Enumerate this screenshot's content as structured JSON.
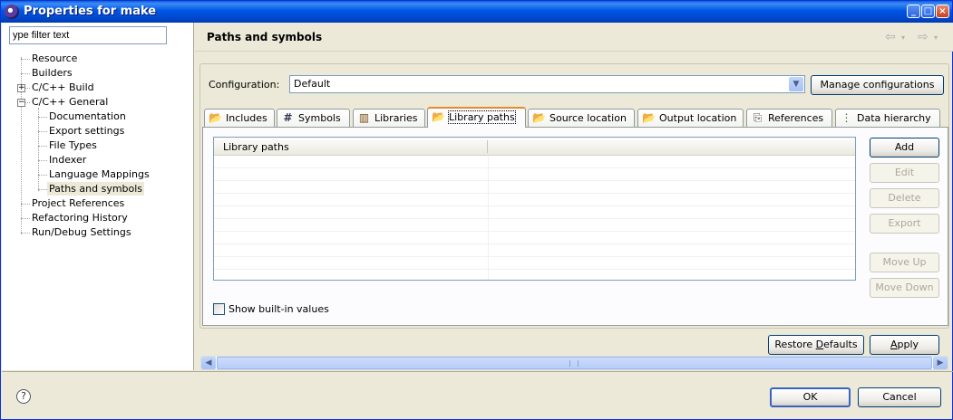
{
  "window": {
    "title": "Properties for make"
  },
  "filter": {
    "value": "ype filter text"
  },
  "tree": {
    "items": [
      {
        "label": "Resource"
      },
      {
        "label": "Builders"
      },
      {
        "label": "C/C++ Build"
      },
      {
        "label": "C/C++ General"
      },
      {
        "label": "Documentation"
      },
      {
        "label": "Export settings"
      },
      {
        "label": "File Types"
      },
      {
        "label": "Indexer"
      },
      {
        "label": "Language Mappings"
      },
      {
        "label": "Paths and symbols",
        "selected": true
      },
      {
        "label": "Project References"
      },
      {
        "label": "Refactoring History"
      },
      {
        "label": "Run/Debug Settings"
      }
    ]
  },
  "page": {
    "title": "Paths and symbols",
    "back_icon": "back-arrow-icon",
    "forward_icon": "forward-arrow-icon"
  },
  "configuration": {
    "label": "Configuration:",
    "value": "Default",
    "manage_button": "Manage configurations"
  },
  "tabs": [
    {
      "label": "Includes",
      "icon": "includes-folder-icon"
    },
    {
      "label": "Symbols",
      "icon": "hash-icon"
    },
    {
      "label": "Libraries",
      "icon": "library-books-icon"
    },
    {
      "label": "Library paths",
      "icon": "library-folder-icon",
      "active": true
    },
    {
      "label": "Source location",
      "icon": "source-folder-icon"
    },
    {
      "label": "Output location",
      "icon": "output-folder-icon"
    },
    {
      "label": "References",
      "icon": "references-icon"
    },
    {
      "label": "Data hierarchy",
      "icon": "hierarchy-icon"
    }
  ],
  "table": {
    "header": "Library paths"
  },
  "side_buttons": {
    "add": "Add",
    "edit": "Edit",
    "delete": "Delete",
    "export": "Export",
    "move_up": "Move Up",
    "move_down": "Move Down"
  },
  "show_builtin": {
    "label": "Show built-in values",
    "checked": false
  },
  "footer": {
    "restore_defaults_pre": "Restore ",
    "restore_defaults_u": "D",
    "restore_defaults_post": "efaults",
    "apply_u": "A",
    "apply_post": "pply",
    "ok": "OK",
    "cancel": "Cancel"
  },
  "colors": {
    "titlebar": "#0055e5",
    "window_bg": "#ece9d8",
    "active_tab_accent": "#e68b2c"
  }
}
